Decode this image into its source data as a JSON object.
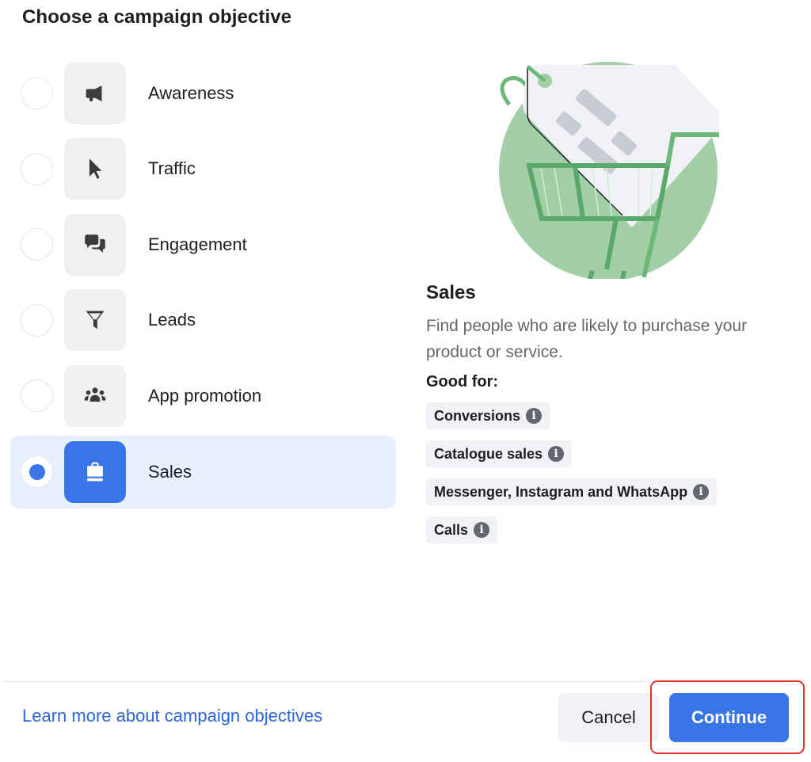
{
  "title": "Choose a campaign objective",
  "objectives": [
    {
      "label": "Awareness",
      "icon": "megaphone-icon",
      "selected": false
    },
    {
      "label": "Traffic",
      "icon": "cursor-icon",
      "selected": false
    },
    {
      "label": "Engagement",
      "icon": "chat-bubbles-icon",
      "selected": false
    },
    {
      "label": "Leads",
      "icon": "funnel-icon",
      "selected": false
    },
    {
      "label": "App promotion",
      "icon": "people-group-icon",
      "selected": false
    },
    {
      "label": "Sales",
      "icon": "shopping-bag-icon",
      "selected": true
    }
  ],
  "detail": {
    "illustration": "price-tag-in-shopping-cart-illustration",
    "title": "Sales",
    "description": "Find people who are likely to purchase your product or service.",
    "good_for_label": "Good for:",
    "good_for": [
      {
        "label": "Conversions",
        "icon": "info-icon"
      },
      {
        "label": "Catalogue sales",
        "icon": "info-icon"
      },
      {
        "label": "Messenger, Instagram and WhatsApp",
        "icon": "info-icon"
      },
      {
        "label": "Calls",
        "icon": "info-icon"
      }
    ]
  },
  "footer": {
    "learn_more": "Learn more about campaign objectives",
    "cancel": "Cancel",
    "continue": "Continue"
  },
  "colors": {
    "accent": "#3875e6",
    "selected_bg": "#e9f0fd",
    "link": "#2e66d3",
    "highlight_border": "#e0342c",
    "illustration_green": "#a3cfa6"
  }
}
